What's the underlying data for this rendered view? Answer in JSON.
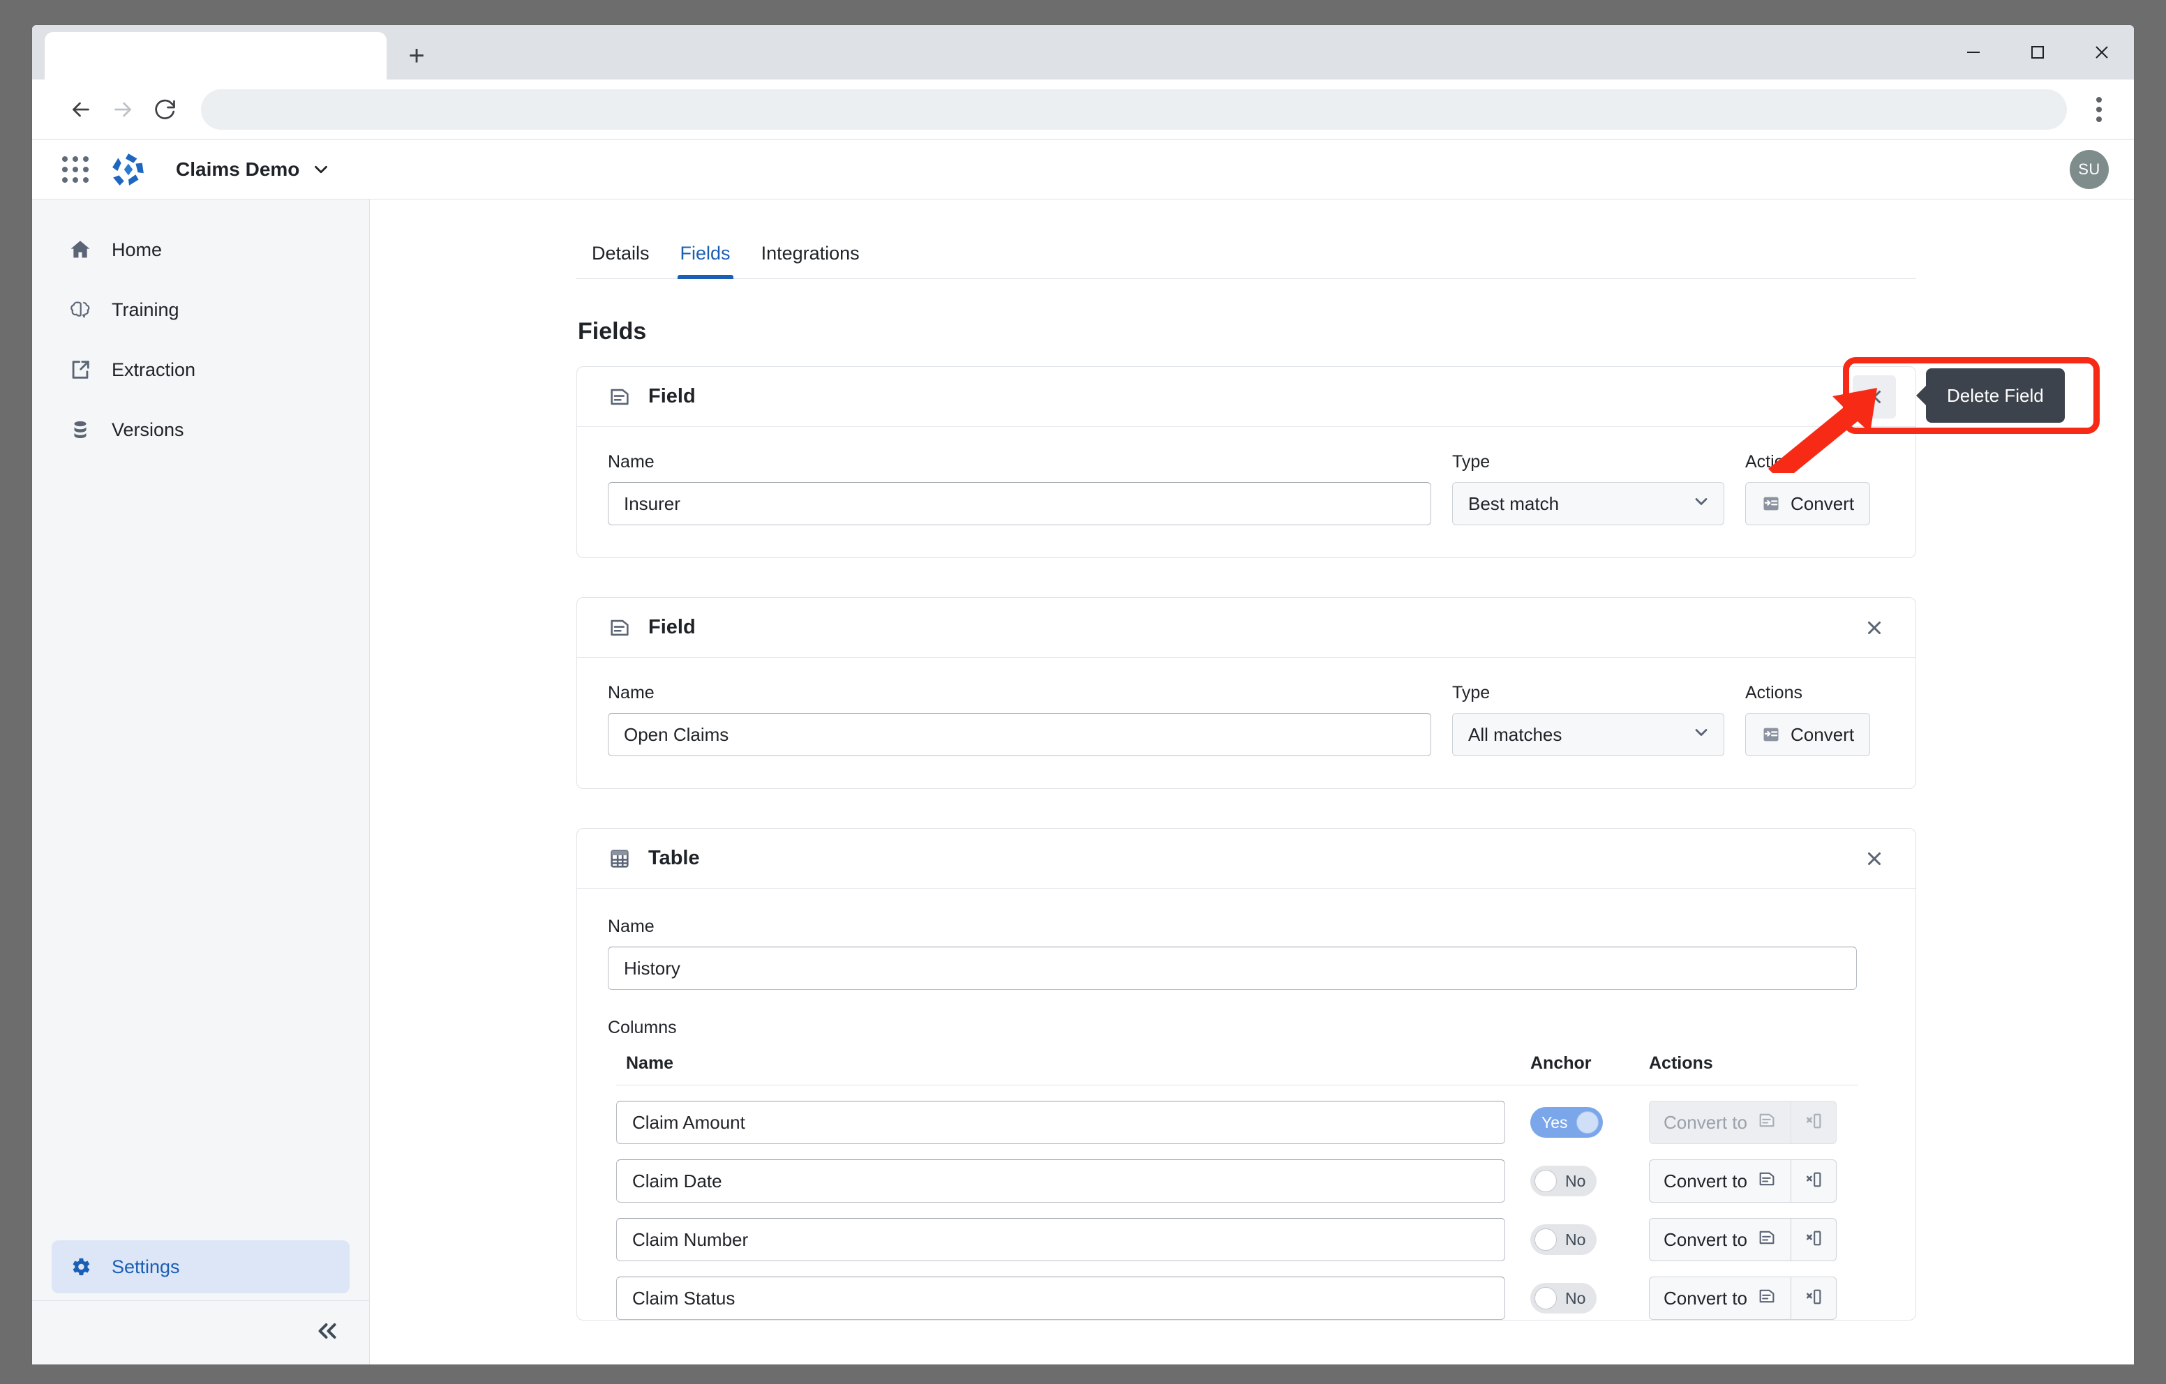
{
  "browser": {
    "tab_title": "",
    "new_tab_label": "+",
    "address_value": "",
    "address_placeholder": "",
    "controls": {
      "back": "back-arrow",
      "forward": "forward-arrow",
      "reload": "reload",
      "menu": "kebab-menu",
      "minimize": "minimize",
      "maximize": "maximize",
      "close": "close"
    }
  },
  "app_header": {
    "apps_grid_icon": "apps-grid-icon",
    "logo_icon": "brand-logo",
    "workspace_name": "Claims Demo",
    "workspace_chevron": "chevron-down-icon",
    "avatar_initials": "SU"
  },
  "sidebar": {
    "items": [
      {
        "label": "Home",
        "icon": "home-icon",
        "active": false
      },
      {
        "label": "Training",
        "icon": "brain-icon",
        "active": false
      },
      {
        "label": "Extraction",
        "icon": "file-export-icon",
        "active": false
      },
      {
        "label": "Versions",
        "icon": "database-icon",
        "active": false
      },
      {
        "label": "Settings",
        "icon": "gear-icon",
        "active": true
      }
    ],
    "collapse_label": "«"
  },
  "content": {
    "tabs": [
      {
        "label": "Details",
        "active": false
      },
      {
        "label": "Fields",
        "active": true
      },
      {
        "label": "Integrations",
        "active": false
      }
    ],
    "page_title": "Fields",
    "field_cards": [
      {
        "icon": "document-icon",
        "title": "Field",
        "name_label": "Name",
        "name_value": "Insurer",
        "type_label": "Type",
        "type_value": "Best match",
        "actions_label": "Actions",
        "convert_label": "Convert",
        "convert_icon": "convert-icon",
        "close_icon": "close-icon",
        "close_hovered": true
      },
      {
        "icon": "document-icon",
        "title": "Field",
        "name_label": "Name",
        "name_value": "Open Claims",
        "type_label": "Type",
        "type_value": "All matches",
        "actions_label": "Actions",
        "convert_label": "Convert",
        "convert_icon": "convert-icon",
        "close_icon": "close-icon",
        "close_hovered": false
      }
    ],
    "table_card": {
      "icon": "table-icon",
      "title": "Table",
      "close_icon": "close-icon",
      "name_label": "Name",
      "name_value": "History",
      "columns_label": "Columns",
      "col_headers": {
        "name": "Name",
        "anchor": "Anchor",
        "actions": "Actions"
      },
      "convert_to_label": "Convert to",
      "convert_to_icon": "document-icon",
      "row_action_icon": "delete-column-icon",
      "rows": [
        {
          "name": "Claim Amount",
          "anchor": "Yes",
          "anchor_on": true,
          "actions_disabled": true
        },
        {
          "name": "Claim Date",
          "anchor": "No",
          "anchor_on": false,
          "actions_disabled": false
        },
        {
          "name": "Claim Number",
          "anchor": "No",
          "anchor_on": false,
          "actions_disabled": false
        },
        {
          "name": "Claim Status",
          "anchor": "No",
          "anchor_on": false,
          "actions_disabled": false
        }
      ]
    }
  },
  "annotation": {
    "tooltip_text": "Delete Field",
    "highlight_color": "#f72b15",
    "arrow_color": "#f72b15"
  },
  "colors": {
    "accent_blue": "#1a5fb4",
    "sidebar_bg": "#f4f6f8",
    "active_nav_bg": "#dde6f7",
    "tooltip_bg": "#3d434d",
    "avatar_bg": "#7e8c8c"
  }
}
